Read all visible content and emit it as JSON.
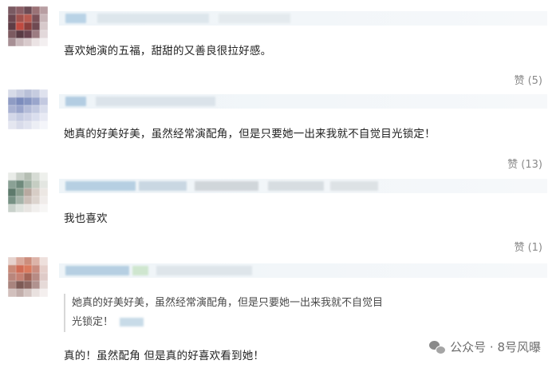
{
  "comments": [
    {
      "text": "喜欢她演的五福，甜甜的又善良很拉好感。",
      "likes": "赞 (5)"
    },
    {
      "text": "她真的好美好美，虽然经常演配角，但是只要她一出来我就不自觉目光锁定！",
      "likes": "赞 (13)"
    },
    {
      "text": "我也喜欢",
      "likes": "赞 (1)"
    },
    {
      "quote_line1": "她真的好美好美，虽然经常演配角，但是只要她一出来我就不自觉目",
      "quote_line2": "光锁定！",
      "text": "真的！虽然配角 但是真的好喜欢看到她！"
    }
  ],
  "watermark": {
    "icon": "wechat-icon",
    "text": "公众号 · 8号风曝"
  },
  "colors": {
    "likes_text": "#8a8a8a",
    "name_bar": "#eef4f8",
    "body_text": "#222222"
  }
}
